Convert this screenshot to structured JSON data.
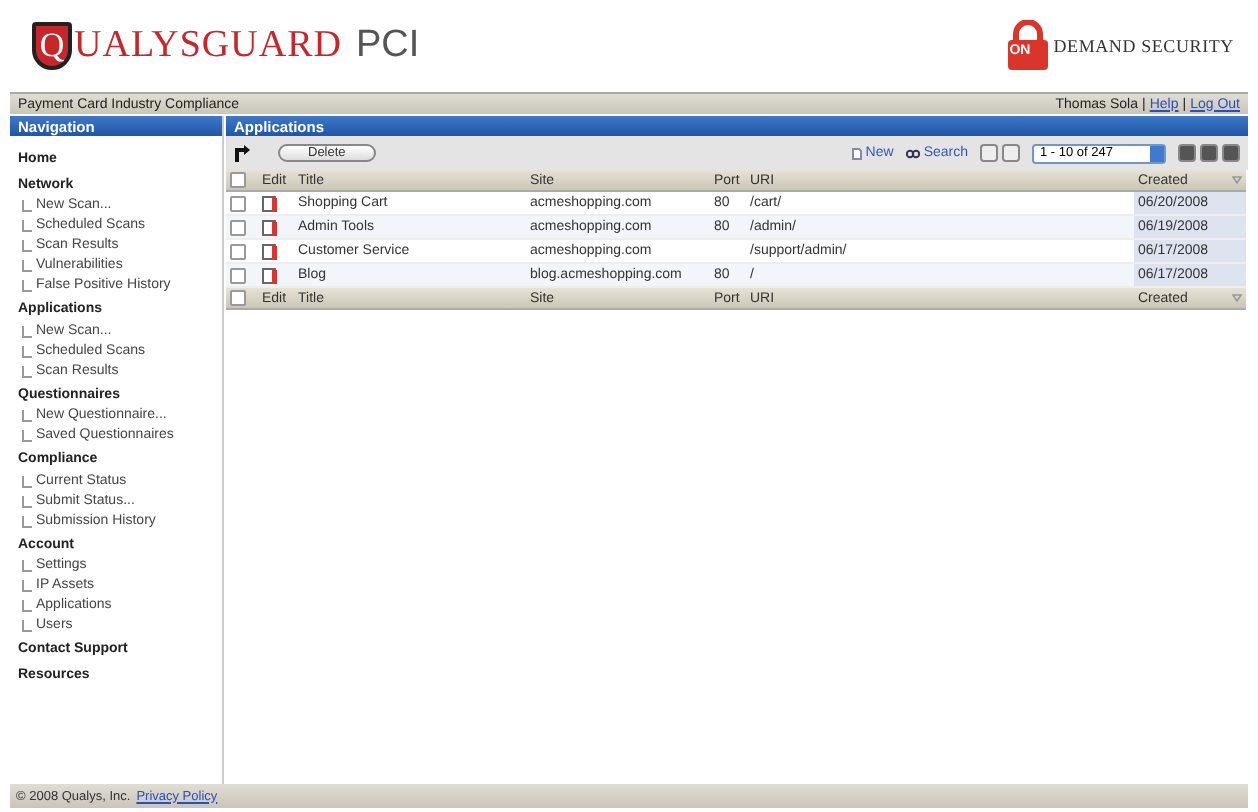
{
  "header": {
    "logo_q": "Q",
    "logo_text": "UALYSGUARD",
    "logo_suffix": "PCI",
    "partner_on": "ON",
    "partner_text": "DEMAND SECURITY"
  },
  "top_bar": {
    "title": "Payment Card Industry Compliance",
    "items": [
      {
        "kind": "text",
        "text": "Thomas Sola"
      },
      {
        "kind": "separator",
        "text": "|"
      },
      {
        "kind": "link",
        "text": "Help"
      },
      {
        "kind": "separator",
        "text": "|"
      },
      {
        "kind": "link",
        "text": "Log Out"
      }
    ]
  },
  "sidebar": {
    "title": "Navigation",
    "items": [
      {
        "label": "Home"
      },
      {
        "label": "Network",
        "children": [
          {
            "label": "New Scan..."
          },
          {
            "label": "Scheduled Scans"
          },
          {
            "label": "Scan Results"
          },
          {
            "label": "Vulnerabilities"
          },
          {
            "label": "False Positive History"
          }
        ]
      },
      {
        "label": "Applications",
        "children": [
          {
            "label": "New Scan..."
          },
          {
            "label": "Scheduled Scans"
          },
          {
            "label": "Scan Results"
          }
        ]
      },
      {
        "label": "Questionnaires",
        "children": [
          {
            "label": "New Questionnaire..."
          },
          {
            "label": "Saved Questionnaires"
          }
        ]
      },
      {
        "label": "Compliance",
        "children": [
          {
            "label": "Current Status"
          },
          {
            "label": "Submit Status..."
          },
          {
            "label": "Submission History"
          }
        ]
      },
      {
        "label": "Account",
        "children": [
          {
            "label": "Settings"
          },
          {
            "label": "IP Assets"
          },
          {
            "label": "Applications"
          },
          {
            "label": "Users"
          }
        ]
      },
      {
        "label": "Contact Support"
      },
      {
        "label": "Resources"
      }
    ]
  },
  "panel": {
    "title": "Applications",
    "toolbar": {
      "delete": "Delete",
      "new": "New",
      "search": "Search",
      "pager": "1 - 10 of 247"
    },
    "table": {
      "header": {
        "checked": false,
        "columns": [
          "Edit",
          "Title",
          "Site",
          "Port",
          "URI",
          "Created"
        ]
      },
      "rows": [
        {
          "checked": false,
          "title": "Shopping Cart",
          "site": "acmeshopping.com",
          "port": "80",
          "uri": "/cart/",
          "created": "06/20/2008"
        },
        {
          "checked": false,
          "title": "Admin Tools",
          "site": "acmeshopping.com",
          "port": "80",
          "uri": "/admin/",
          "created": "06/19/2008"
        },
        {
          "checked": false,
          "title": "Customer Service",
          "site": "acmeshopping.com",
          "uri": "/support/admin/",
          "created": "06/17/2008"
        },
        {
          "checked": false,
          "title": "Blog",
          "site": "blog.acmeshopping.com",
          "port": "80",
          "uri": "/",
          "created": "06/17/2008"
        }
      ],
      "footer_header": {
        "checked": false,
        "columns": [
          "Edit",
          "Title",
          "Site",
          "Port",
          "URI",
          "Created"
        ]
      }
    }
  },
  "footer": {
    "copyright": "© 2008 Qualys, Inc.",
    "link": "Privacy Policy"
  }
}
